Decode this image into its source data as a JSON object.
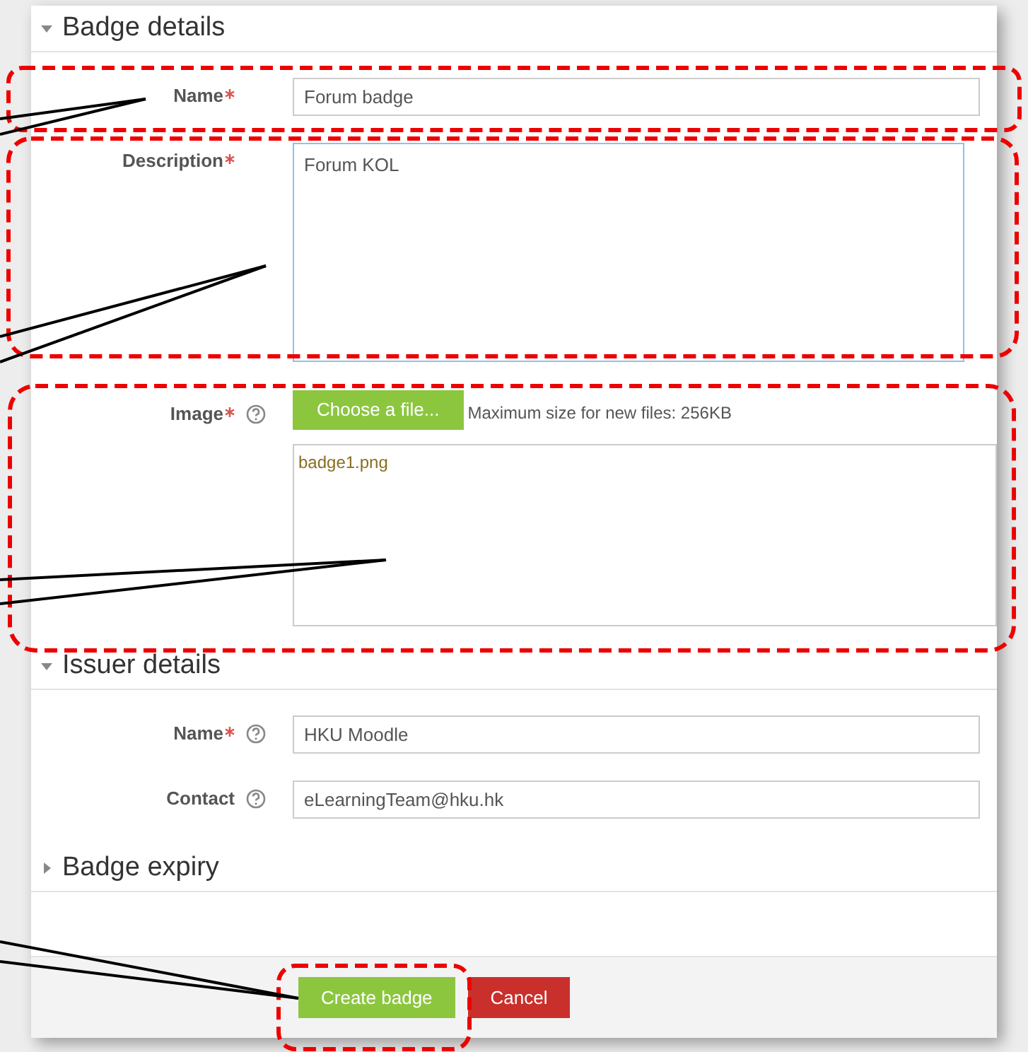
{
  "sections": [
    {
      "title": "Badge details",
      "expanded": true,
      "fields": [
        {
          "kind": "text",
          "label": "Name",
          "required": true,
          "help": false,
          "value": "Forum badge"
        },
        {
          "kind": "textarea",
          "label": "Description",
          "required": true,
          "help": false,
          "value": "Forum KOL"
        },
        {
          "kind": "file",
          "label": "Image",
          "required": true,
          "help": true,
          "button": "Choose a file...",
          "note": "Maximum size for new files: 256KB",
          "files": [
            "badge1.png"
          ]
        }
      ]
    },
    {
      "title": "Issuer details",
      "expanded": true,
      "fields": [
        {
          "kind": "text",
          "label": "Name",
          "required": true,
          "help": true,
          "value": "HKU Moodle"
        },
        {
          "kind": "text",
          "label": "Contact",
          "required": false,
          "help": true,
          "value": "eLearningTeam@hku.hk"
        }
      ]
    },
    {
      "title": "Badge expiry",
      "expanded": false
    }
  ],
  "buttons": [
    {
      "label": "Create badge",
      "kind": "primary"
    },
    {
      "label": "Cancel",
      "kind": "danger"
    }
  ]
}
